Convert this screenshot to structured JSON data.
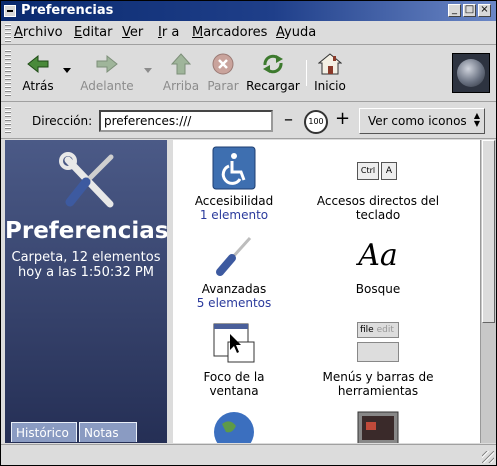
{
  "window": {
    "title": "Preferencias"
  },
  "menu": [
    {
      "label": "Archivo",
      "mn": "A",
      "rest": "rchivo"
    },
    {
      "label": "Editar",
      "mn": "E",
      "rest": "ditar"
    },
    {
      "label": "Ver",
      "mn": "V",
      "rest": "er"
    },
    {
      "label": "Ir a",
      "mn": "I",
      "rest": "r a"
    },
    {
      "label": "Marcadores",
      "mn": "M",
      "rest": "arcadores"
    },
    {
      "label": "Ayuda",
      "mn": "A",
      "rest": "yuda"
    }
  ],
  "toolbar": {
    "back": "Atrás",
    "forward": "Adelante",
    "up": "Arriba",
    "stop": "Parar",
    "reload": "Recargar",
    "home": "Inicio"
  },
  "location": {
    "label": "Dirección:",
    "value": "preferences:///",
    "zoom": "100",
    "view_mode": "Ver como iconos"
  },
  "sidebar": {
    "title": "Preferencias",
    "line1": "Carpeta, 12 elementos",
    "line2": "hoy a las 1:50:32 PM",
    "tabs": [
      "Histórico",
      "Notas"
    ]
  },
  "items": [
    {
      "label": "Accesibilidad",
      "count": "1 elemento",
      "icon": "accessibility-icon"
    },
    {
      "label": "Accesos directos del",
      "label2": "teclado",
      "icon": "keyboard-shortcuts-icon",
      "keys": [
        "Ctrl",
        "A"
      ]
    },
    {
      "label": "Avanzadas",
      "count": "5 elementos",
      "icon": "screwdriver-icon"
    },
    {
      "label": "Bosque",
      "icon": "font-icon",
      "glyph": "Aa"
    },
    {
      "label": "Foco de la ventana",
      "icon": "window-focus-icon"
    },
    {
      "label": "Menús y barras de",
      "label2": "herramientas",
      "icon": "menus-toolbars-icon",
      "words": [
        "file",
        "edit"
      ]
    },
    {
      "label": "",
      "icon": "globe-icon"
    },
    {
      "label": "",
      "icon": "monitor-icon"
    }
  ],
  "colors": {
    "titlebar": "#0a2a6e",
    "sidebar": "#4b5a87",
    "count_text": "#2a3a9c"
  }
}
